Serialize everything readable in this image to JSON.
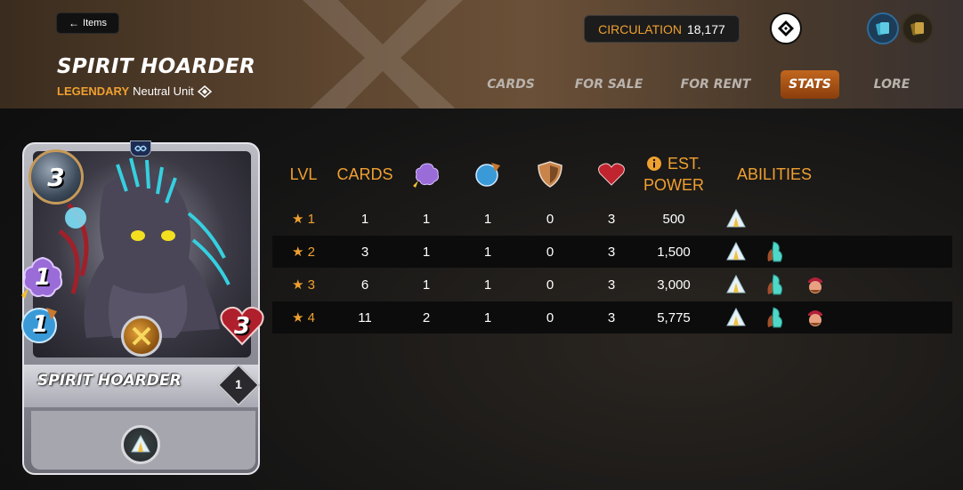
{
  "header": {
    "back_label": "Items",
    "title": "SPIRIT HOARDER",
    "rarity": "LEGENDARY",
    "unit_type": "Neutral Unit",
    "circulation_label": "CIRCULATION",
    "circulation_value": "18,177",
    "tabs": [
      {
        "label": "CARDS",
        "active": false
      },
      {
        "label": "FOR SALE",
        "active": false
      },
      {
        "label": "FOR RENT",
        "active": false
      },
      {
        "label": "STATS",
        "active": true
      },
      {
        "label": "LORE",
        "active": false
      }
    ]
  },
  "card": {
    "name": "SPIRIT HOARDER",
    "mana": "3",
    "magic": "1",
    "speed": "1",
    "health": "3",
    "level": "1",
    "ability_icon": "shield-tent-icon"
  },
  "table": {
    "headers": {
      "lvl": "LVL",
      "cards": "CARDS",
      "magic_icon": "magic-attack-icon",
      "speed_icon": "speed-icon",
      "armor_icon": "armor-icon",
      "health_icon": "health-icon",
      "est_line1": "EST.",
      "est_line2": "POWER",
      "abilities": "ABILITIES"
    },
    "rows": [
      {
        "star": "★",
        "lvl": "1",
        "cards": "1",
        "magic": "1",
        "speed": "1",
        "armor": "0",
        "health": "3",
        "power": "500",
        "abilities": [
          "shield-tent-icon"
        ]
      },
      {
        "star": "★",
        "lvl": "2",
        "cards": "3",
        "magic": "1",
        "speed": "1",
        "armor": "0",
        "health": "3",
        "power": "1,500",
        "abilities": [
          "shield-tent-icon",
          "spirit-hand-icon"
        ]
      },
      {
        "star": "★",
        "lvl": "3",
        "cards": "6",
        "magic": "1",
        "speed": "1",
        "armor": "0",
        "health": "3",
        "power": "3,000",
        "abilities": [
          "shield-tent-icon",
          "spirit-hand-icon",
          "red-hat-face-icon"
        ]
      },
      {
        "star": "★",
        "lvl": "4",
        "cards": "11",
        "magic": "2",
        "speed": "1",
        "armor": "0",
        "health": "3",
        "power": "5,775",
        "abilities": [
          "shield-tent-icon",
          "spirit-hand-icon",
          "red-hat-face-icon"
        ]
      }
    ]
  },
  "colors": {
    "accent_orange": "#f0a030",
    "active_tab": "#b45a18"
  }
}
